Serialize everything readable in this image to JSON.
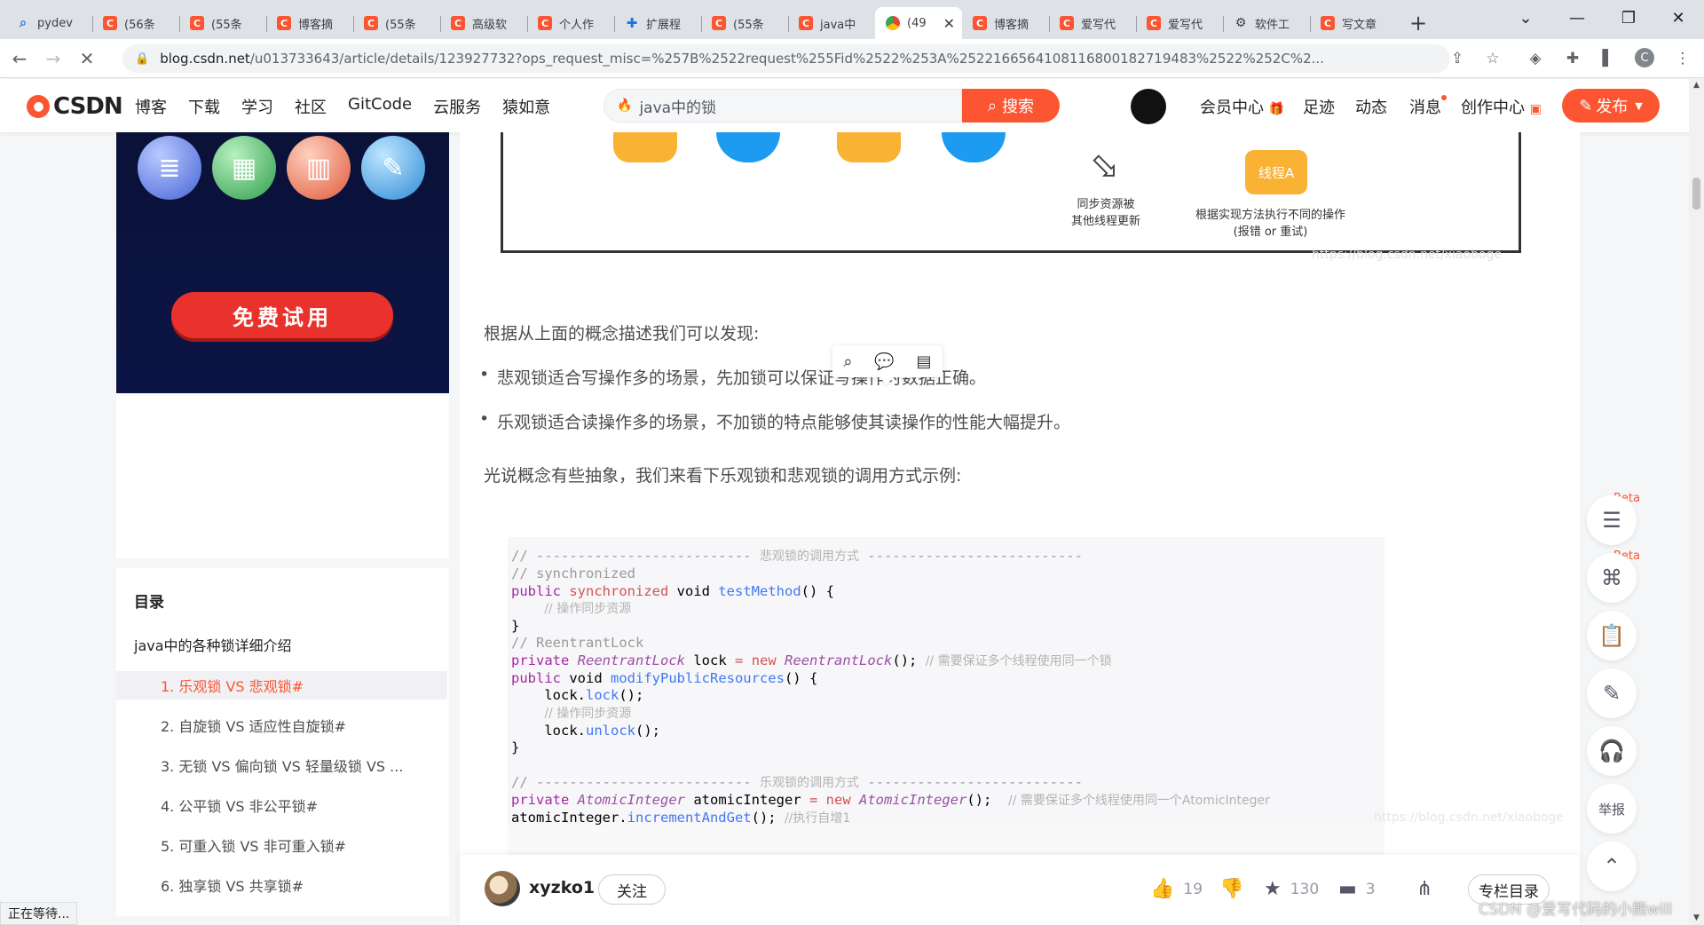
{
  "browser": {
    "tabs": [
      {
        "label": "pydev",
        "icon": "search-icon"
      },
      {
        "label": "(56条",
        "icon": "csdn-icon"
      },
      {
        "label": "(55条",
        "icon": "csdn-icon"
      },
      {
        "label": "博客摘",
        "icon": "csdn-icon"
      },
      {
        "label": "(55条",
        "icon": "csdn-icon"
      },
      {
        "label": "高级软",
        "icon": "csdn-icon"
      },
      {
        "label": "个人作",
        "icon": "csdn-icon"
      },
      {
        "label": "扩展程",
        "icon": "puzzle-icon"
      },
      {
        "label": "(55条",
        "icon": "csdn-icon"
      },
      {
        "label": "java中",
        "icon": "csdn-icon"
      },
      {
        "label": "(49",
        "icon": "chrome-icon",
        "active": true
      },
      {
        "label": "博客摘",
        "icon": "csdn-icon"
      },
      {
        "label": "爱写代",
        "icon": "csdn-icon"
      },
      {
        "label": "爱写代",
        "icon": "csdn-icon"
      },
      {
        "label": "软件工",
        "icon": "devtools-icon"
      },
      {
        "label": "写文章",
        "icon": "csdn-icon"
      }
    ],
    "url_host": "blog.csdn.net",
    "url_rest": "/u013733643/article/details/123927732?ops_request_misc=%257B%2522request%255Fid%2522%253A%2522166564108116800182719483%2522%252C%2...",
    "status_text": "正在等待..."
  },
  "header": {
    "logo_text": "CSDN",
    "nav": [
      "博客",
      "下载",
      "学习",
      "社区",
      "GitCode",
      "云服务",
      "猿如意"
    ],
    "search_value": "java中的锁",
    "search_button": "搜索",
    "links": [
      "会员中心",
      "足迹",
      "动态",
      "消息",
      "创作中心"
    ],
    "publish_button": "发布"
  },
  "sidebar": {
    "ad_button": "免费试用",
    "toc_title": "目录",
    "toc": [
      {
        "label": "java中的各种锁详细介绍",
        "level": 1
      },
      {
        "label": "1. 乐观锁 VS 悲观锁#",
        "level": 2,
        "active": true
      },
      {
        "label": "2. 自旋锁 VS 适应性自旋锁#",
        "level": 2
      },
      {
        "label": "3. 无锁 VS 偏向锁 VS 轻量级锁 VS ...",
        "level": 2
      },
      {
        "label": "4. 公平锁 VS 非公平锁#",
        "level": 2
      },
      {
        "label": "5. 可重入锁 VS 非可重入锁#",
        "level": 2
      },
      {
        "label": "6. 独享锁 VS 共享锁#",
        "level": 2
      }
    ]
  },
  "article": {
    "figure": {
      "note_left_1": "同步资源被",
      "note_left_2": "其他线程更新",
      "thread_label": "线程A",
      "note_right_1": "根据实现方法执行不同的操作",
      "note_right_2": "(报错 or 重试)",
      "watermark": "https://blog.csdn.net/xiaoboge"
    },
    "p1": "根据从上面的概念描述我们可以发现:",
    "bullets": [
      "悲观锁适合写操作多的场景，先加锁可以保证写操作时数据正确。",
      "乐观锁适合读操作多的场景，不加锁的特点能够使其读操作的性能大幅提升。"
    ],
    "p2": "光说概念有些抽象，我们来看下乐观锁和悲观锁的调用方式示例:",
    "code": {
      "pess_header": "悲观锁的调用方式",
      "opt_header": "乐观锁的调用方式",
      "c_sync": "// synchronized",
      "c_op_sync": "// 操作同步资源",
      "c_reentrant": "// ReentrantLock",
      "c_same_lock": "// 需要保证多个线程使用同一个锁",
      "c_same_atomic": "// 需要保证多个线程使用同一个AtomicInteger",
      "c_incr": "//执行自增1",
      "watermark": "https://blog.csdn.net/xiaoboge"
    }
  },
  "author": {
    "name": "xyzko1",
    "follow": "关注",
    "likes": "19",
    "favorites": "130",
    "comments": "3",
    "column_button": "专栏目录"
  },
  "float_bar": {
    "beta": "Beta",
    "report": "举报"
  },
  "footer_watermark": "CSDN @爱写代码的小熊will"
}
